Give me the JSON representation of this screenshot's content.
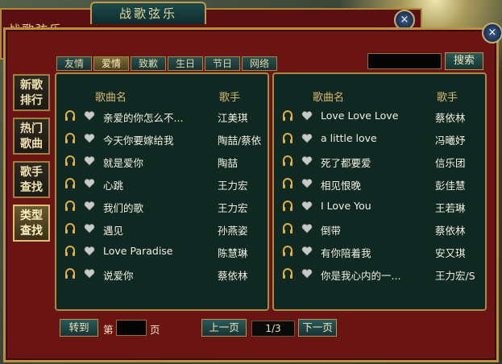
{
  "window": {
    "back_title": "战歌弦乐",
    "front_title": "战歌弦乐",
    "close_icon": "×"
  },
  "side_nav": [
    {
      "line1": "新歌",
      "line2": "排行"
    },
    {
      "line1": "热门",
      "line2": "歌曲"
    },
    {
      "line1": "歌手",
      "line2": "查找"
    },
    {
      "line1": "类型",
      "line2": "查找"
    }
  ],
  "category_tabs": [
    "友情",
    "爱情",
    "致歉",
    "生日",
    "节日",
    "网络"
  ],
  "search": {
    "button": "搜索"
  },
  "table_headers": {
    "song": "歌曲名",
    "artist": "歌手"
  },
  "left_songs": [
    {
      "song": "亲爱的你怎么不...",
      "artist": "江美琪"
    },
    {
      "song": "今天你要嫁给我",
      "artist": "陶喆/蔡依"
    },
    {
      "song": "就是爱你",
      "artist": "陶喆"
    },
    {
      "song": "心跳",
      "artist": "王力宏"
    },
    {
      "song": "我们的歌",
      "artist": "王力宏"
    },
    {
      "song": "遇见",
      "artist": "孙燕姿"
    },
    {
      "song": "Love Paradise",
      "artist": "陈慧琳"
    },
    {
      "song": "说爱你",
      "artist": "蔡依林"
    }
  ],
  "right_songs": [
    {
      "song": "Love Love Love",
      "artist": "蔡依林"
    },
    {
      "song": "a little love",
      "artist": "冯曦妤"
    },
    {
      "song": "死了都要爱",
      "artist": "信乐团"
    },
    {
      "song": "相见恨晚",
      "artist": "彭佳慧"
    },
    {
      "song": "I Love You",
      "artist": "王若琳"
    },
    {
      "song": "倒带",
      "artist": "蔡依林"
    },
    {
      "song": "有你陪着我",
      "artist": "安又琪"
    },
    {
      "song": "你是我心内的一...",
      "artist": "王力宏/S"
    }
  ],
  "pager": {
    "goto_label": "转到",
    "page_prefix": "第",
    "page_suffix": "页",
    "prev_label": "上一页",
    "indicator": "1/3",
    "next_label": "下一页"
  },
  "colors": {
    "frame": "#6b1414",
    "border_gold": "#b8903e",
    "panel": "#102822",
    "text": "#f2efe2",
    "header": "#d8b870"
  }
}
